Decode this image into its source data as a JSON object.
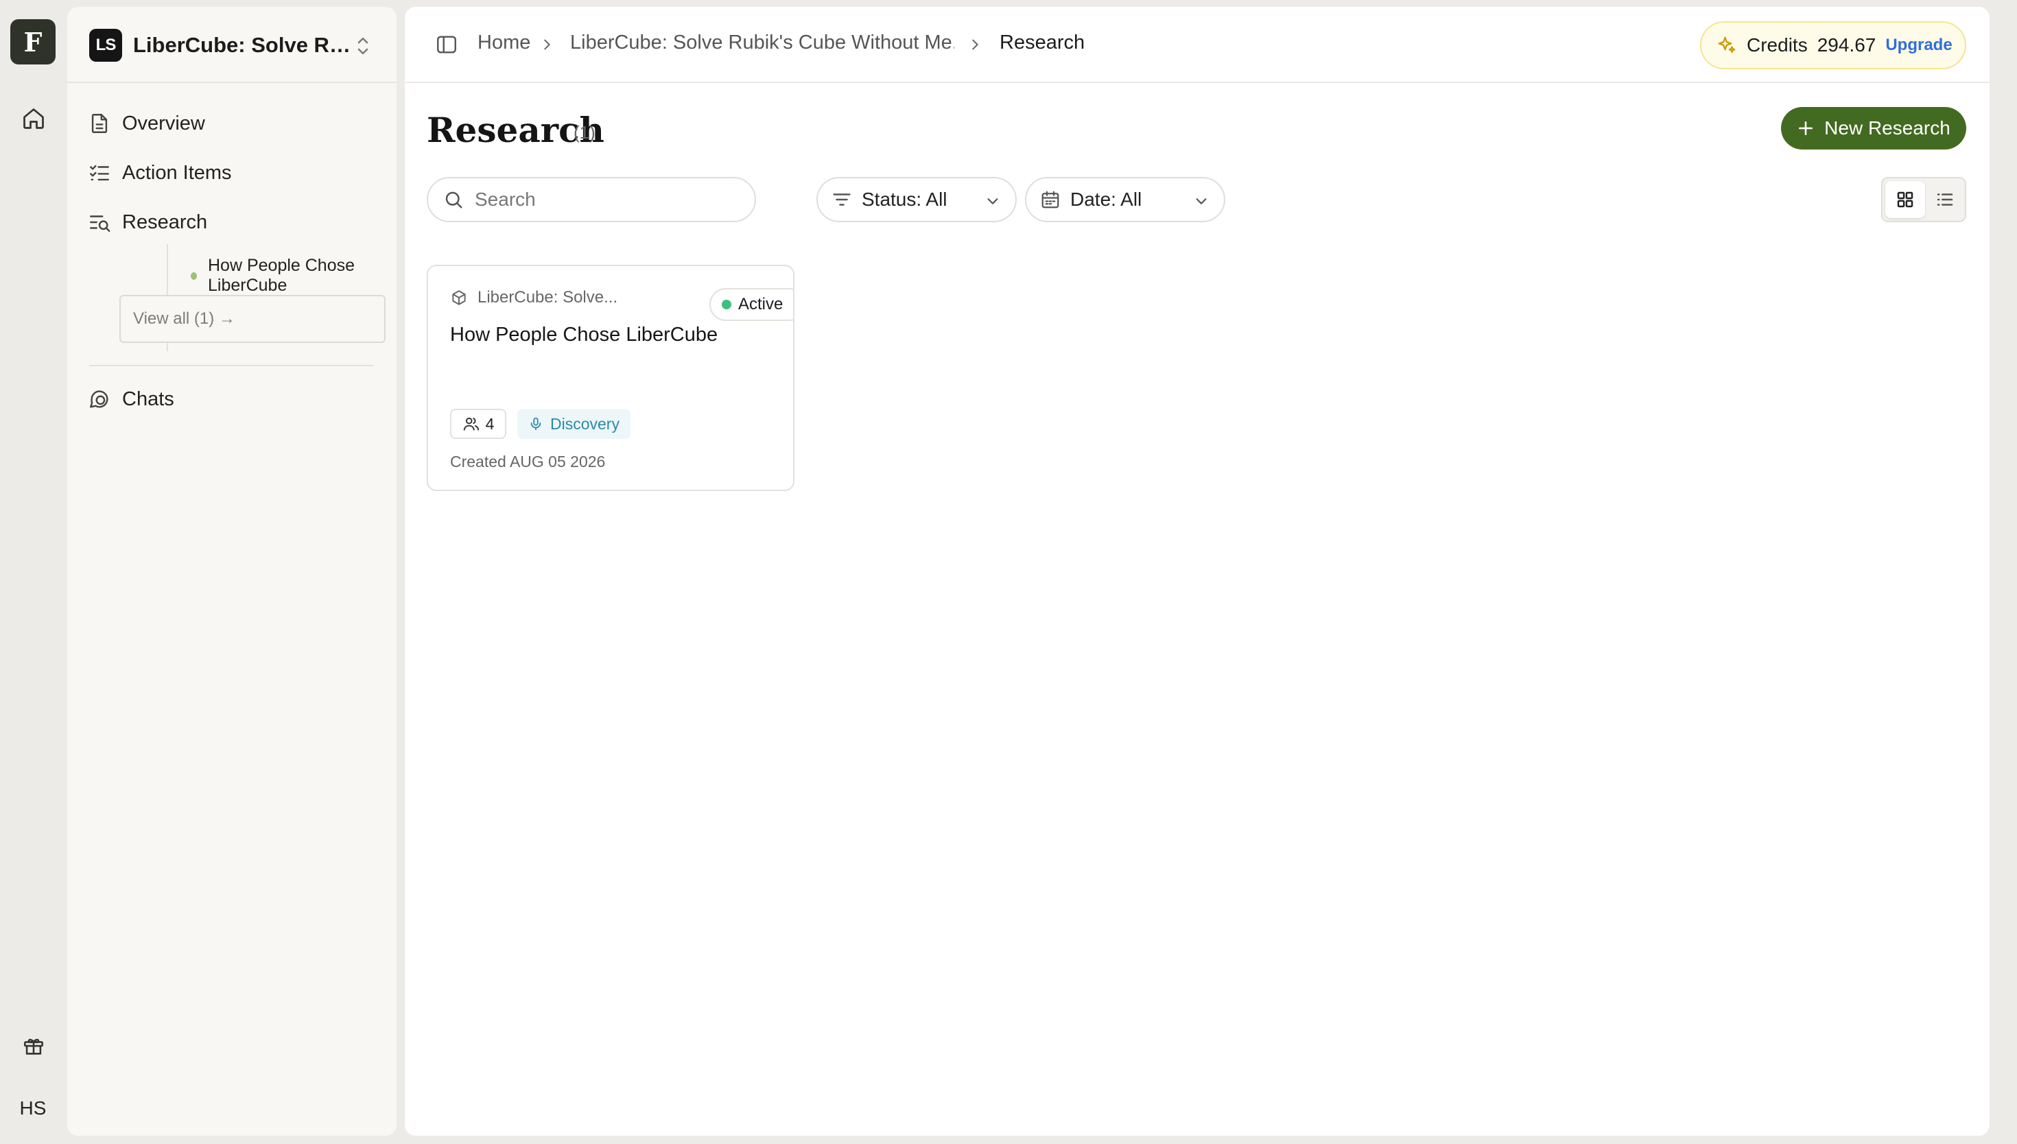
{
  "rail": {
    "logo_letter": "F",
    "user_initials": "HS"
  },
  "workspace": {
    "badge": "LS",
    "name": "LiberCube: Solve Ru..."
  },
  "sidebar": {
    "items": [
      {
        "label": "Overview",
        "icon": "document-icon"
      },
      {
        "label": "Action Items",
        "icon": "checklist-icon"
      },
      {
        "label": "Research",
        "icon": "search-list-icon"
      },
      {
        "label": "Chats",
        "icon": "chat-icon"
      }
    ],
    "research_children": [
      {
        "label": "How People Chose LiberCube"
      }
    ],
    "view_all": "View all (1) →"
  },
  "breadcrumb": {
    "home": "Home",
    "project": "LiberCube: Solve Rubik's Cube Without Me...",
    "current": "Research"
  },
  "credits": {
    "label": "Credits",
    "value": "294.67",
    "upgrade": "Upgrade"
  },
  "page": {
    "title": "Research",
    "count": "(1)",
    "new_button": "New Research"
  },
  "filters": {
    "search_placeholder": "Search",
    "status": "Status: All",
    "date": "Date: All"
  },
  "cards": [
    {
      "project": "LiberCube: Solve...",
      "status": "Active",
      "title": "How People Chose LiberCube",
      "participants": "4",
      "type": "Discovery",
      "created": "Created AUG 05 2026"
    }
  ],
  "help": {
    "letter": "F"
  },
  "colors": {
    "accent_green": "#436a21",
    "status_active": "#3ec07c",
    "upgrade_blue": "#2f6fdc",
    "discovery_teal": "#2b8aa6"
  }
}
